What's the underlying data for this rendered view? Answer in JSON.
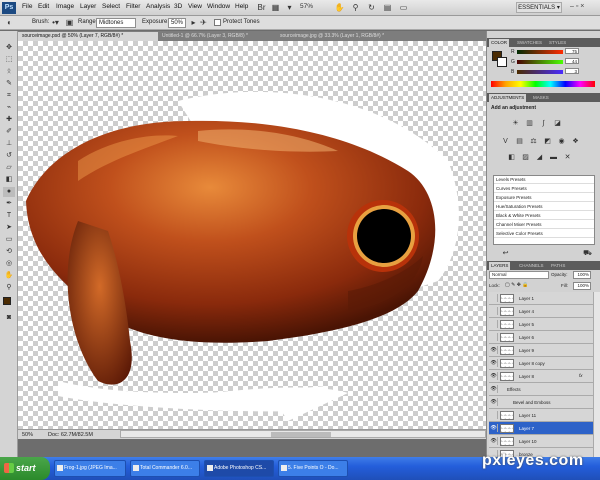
{
  "menu": {
    "logo": "Ps",
    "items": [
      "File",
      "Edit",
      "Image",
      "Layer",
      "Select",
      "Filter",
      "Analysis",
      "3D",
      "View",
      "Window",
      "Help"
    ],
    "zoom": "57%",
    "workspace": "ESSENTIALS ▾",
    "window_controls": "– ▫ ×"
  },
  "options": {
    "brush_label": "Brush:",
    "range_label": "Range:",
    "range_value": "Midtones",
    "exposure_label": "Exposure:",
    "exposure_value": "50%",
    "protect_tones": "Protect Tones"
  },
  "tabs": [
    "sourceimage.psd @ 50% (Layer 7, RGB/8#) *",
    "Untitled-1 @ 66.7% (Layer 3, RGB/8) *",
    "sourceimage.jpg @ 33.3% (Layer 1, RGB/8#) *"
  ],
  "status": {
    "zoom": "50%",
    "doc": "Doc: 62.7M/82.5M"
  },
  "color_panel": {
    "tabs": [
      "COLOR",
      "SWATCHES",
      "STYLES"
    ],
    "r": "75",
    "g": "44",
    "b": "3"
  },
  "adjustments": {
    "tabs": [
      "ADJUSTMENTS",
      "MASKS"
    ],
    "heading": "Add an adjustment",
    "presets": [
      "Levels Presets",
      "Curves Presets",
      "Exposure Presets",
      "Hue/Saturation Presets",
      "Black & White Presets",
      "Channel Mixer Presets",
      "Selective Color Presets"
    ]
  },
  "layers_panel": {
    "tabs": [
      "LAYERS",
      "CHANNELS",
      "PATHS"
    ],
    "blend_mode": "Normal",
    "opacity_label": "Opacity:",
    "opacity": "100%",
    "lock_label": "Lock:",
    "fill_label": "Fill:",
    "fill": "100%",
    "layers": [
      {
        "name": "Layer 1",
        "visible": false,
        "selected": false
      },
      {
        "name": "Layer 4",
        "visible": false,
        "selected": false
      },
      {
        "name": "Layer 5",
        "visible": false,
        "selected": false
      },
      {
        "name": "Layer 6",
        "visible": false,
        "selected": false
      },
      {
        "name": "Layer 9",
        "visible": true,
        "selected": false
      },
      {
        "name": "Layer 8 copy",
        "visible": true,
        "selected": false
      },
      {
        "name": "Layer 8",
        "visible": true,
        "selected": false
      },
      {
        "name": "Effects",
        "visible": true,
        "selected": false
      },
      {
        "name": "Bevel and Emboss",
        "visible": true,
        "selected": false
      },
      {
        "name": "Layer 11",
        "visible": false,
        "selected": false
      },
      {
        "name": "Layer 7",
        "visible": true,
        "selected": true
      },
      {
        "name": "Layer 10",
        "visible": true,
        "selected": false
      },
      {
        "name": "bronze",
        "visible": false,
        "selected": false
      }
    ],
    "fx_label": "fx"
  },
  "taskbar": {
    "start": "start",
    "tasks": [
      "Frog-1.jpg (JPEG Ima...",
      "Total Commander 6.0...",
      "Adobe Photoshop CS...",
      "5. Five Points O - Do..."
    ],
    "watermark": "pxleyes.com"
  },
  "colors": {
    "foreground": "#4b2c03",
    "background": "#ffffff",
    "selected_layer": "#2d62c8",
    "taskbar": "#245edb"
  }
}
